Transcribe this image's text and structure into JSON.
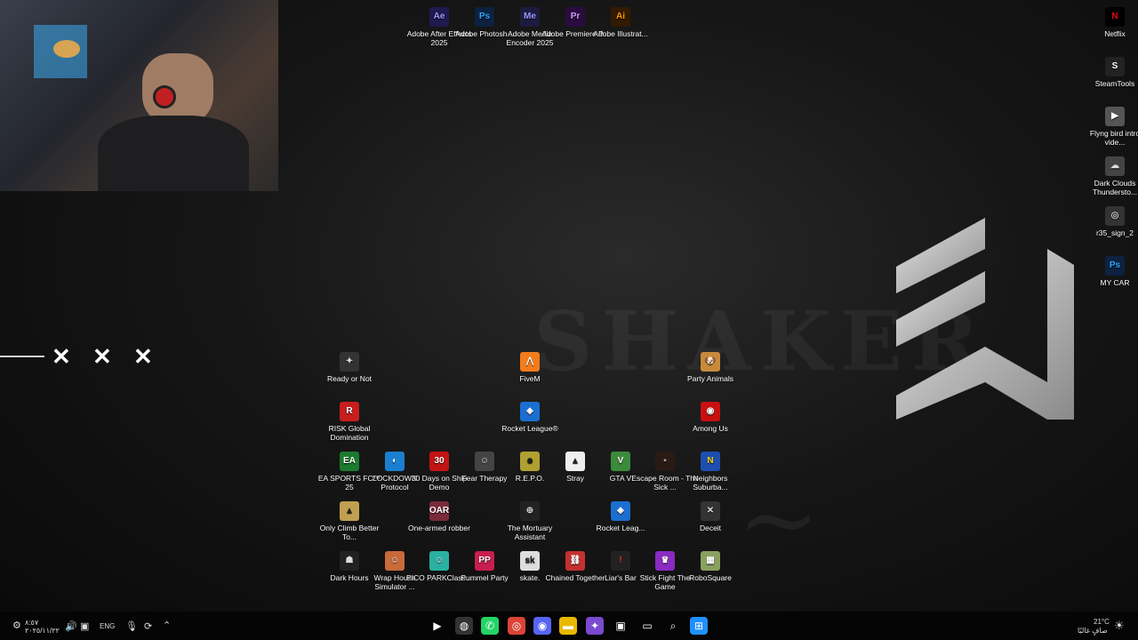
{
  "wallpaper": {
    "brand_text": "SHAKER"
  },
  "top_icons": [
    {
      "label": "Adobe After Effects 2025",
      "glyph": "Ae",
      "color": "#1f1a4f",
      "fg": "#9f9cff"
    },
    {
      "label": "Adobe Photosh...",
      "glyph": "Ps",
      "color": "#0c2240",
      "fg": "#31a8ff"
    },
    {
      "label": "Adobe Media Encoder 2025",
      "glyph": "Me",
      "color": "#1e1a3f",
      "fg": "#9b9bff"
    },
    {
      "label": "Adobe Premiere P...",
      "glyph": "Pr",
      "color": "#2a0c3f",
      "fg": "#d59bff"
    },
    {
      "label": "Adobe Illustrat...",
      "glyph": "Ai",
      "color": "#331a00",
      "fg": "#ff9a00"
    }
  ],
  "right_icons": [
    {
      "label": "Netflix",
      "glyph": "N",
      "color": "#000",
      "fg": "#e50914"
    },
    {
      "label": "SteamTools",
      "glyph": "S",
      "color": "#222",
      "fg": "#fff"
    },
    {
      "label": "Flyng bird intro vide...",
      "glyph": "▶",
      "color": "#555",
      "fg": "#fff"
    },
    {
      "label": "Dark Clouds Thundersto...",
      "glyph": "☁",
      "color": "#444",
      "fg": "#ddd"
    },
    {
      "label": "r35_sign_2",
      "glyph": "◎",
      "color": "#333",
      "fg": "#ccc"
    },
    {
      "label": "MY CAR",
      "glyph": "Ps",
      "color": "#0c2240",
      "fg": "#31a8ff"
    }
  ],
  "grid_icons": [
    {
      "label": "Ready or Not",
      "glyph": "✦",
      "color": "#333",
      "fg": "#ddd"
    },
    {
      "label": "FiveM",
      "glyph": "⋀",
      "color": "#f47c1c",
      "fg": "#fff"
    },
    {
      "label": "Party Animals",
      "glyph": "🐶",
      "color": "#c88a3a",
      "fg": "#fff"
    },
    {
      "label": "RISK Global Domination",
      "glyph": "R",
      "color": "#c81e1e",
      "fg": "#fff"
    },
    {
      "label": "Rocket League®",
      "glyph": "◈",
      "color": "#1a6fd1",
      "fg": "#fff"
    },
    {
      "label": "Among Us",
      "glyph": "◉",
      "color": "#c81010",
      "fg": "#fff"
    },
    {
      "label": "EA SPORTS FC™ 25",
      "glyph": "EA",
      "color": "#1c7a2e",
      "fg": "#fff"
    },
    {
      "label": "LOCKDOWN Protocol",
      "glyph": "◐",
      "color": "#1a7fd0",
      "fg": "#fff"
    },
    {
      "label": "30 Days on Ship Demo",
      "glyph": "30",
      "color": "#c31414",
      "fg": "#fff"
    },
    {
      "label": "Fear Therapy",
      "glyph": "☺",
      "color": "#444",
      "fg": "#eee"
    },
    {
      "label": "R.E.P.O.",
      "glyph": "☻",
      "color": "#b0a030",
      "fg": "#222"
    },
    {
      "label": "Stray",
      "glyph": "▲",
      "color": "#eee",
      "fg": "#222"
    },
    {
      "label": "GTA V",
      "glyph": "V",
      "color": "#3c8a3c",
      "fg": "#fff"
    },
    {
      "label": "Escape Room - The Sick ...",
      "glyph": "▪",
      "color": "#2a1a14",
      "fg": "#aaa"
    },
    {
      "label": "Neighbors Suburba...",
      "glyph": "N",
      "color": "#1e4fb0",
      "fg": "#ffd400"
    },
    {
      "label": "Only Climb Better To...",
      "glyph": "▲",
      "color": "#c0a050",
      "fg": "#222"
    },
    {
      "label": "One-armed robber",
      "glyph": "OAR",
      "color": "#7a2a3a",
      "fg": "#fff"
    },
    {
      "label": "The Mortuary Assistant",
      "glyph": "⊕",
      "color": "#222",
      "fg": "#ccc"
    },
    {
      "label": "Rocket Leag...",
      "glyph": "◈",
      "color": "#1a6fd1",
      "fg": "#fff"
    },
    {
      "label": "Deceit",
      "glyph": "✕",
      "color": "#333",
      "fg": "#ddd"
    },
    {
      "label": "Dark Hours",
      "glyph": "☗",
      "color": "#222",
      "fg": "#ddd"
    },
    {
      "label": "Wrap House Simulator ...",
      "glyph": "☺",
      "color": "#c86a3a",
      "fg": "#fff"
    },
    {
      "label": "PICO PARKClass...",
      "glyph": "☺",
      "color": "#2ab0a0",
      "fg": "#fff"
    },
    {
      "label": "Pummel Party",
      "glyph": "PP",
      "color": "#c81e4e",
      "fg": "#fff"
    },
    {
      "label": "skate.",
      "glyph": "sk",
      "color": "#ddd",
      "fg": "#222"
    },
    {
      "label": "Chained Together",
      "glyph": "⛓",
      "color": "#c43030",
      "fg": "#fff"
    },
    {
      "label": "Liar's Bar",
      "glyph": "!",
      "color": "#222",
      "fg": "#e33"
    },
    {
      "label": "Stick Fight The Game",
      "glyph": "♛",
      "color": "#8a2ac0",
      "fg": "#fff"
    },
    {
      "label": "RoboSquare",
      "glyph": "▦",
      "color": "#8aa060",
      "fg": "#fff"
    }
  ],
  "overlay_marks": [
    "✕",
    "✕",
    "✕"
  ],
  "taskbar": {
    "language": "ENG",
    "time": "٨:٥٧",
    "date": "٢٠٢٥/١١/٢٢",
    "weather_temp": "21°C",
    "weather_desc": "صافٍ غالبًا",
    "apps": [
      {
        "name": "windows-start",
        "glyph": "⊞",
        "color": "#1e90ff"
      },
      {
        "name": "search",
        "glyph": "⌕",
        "color": "transparent"
      },
      {
        "name": "task-view",
        "glyph": "▭",
        "color": "transparent"
      },
      {
        "name": "store",
        "glyph": "▣",
        "color": "transparent"
      },
      {
        "name": "copilot",
        "glyph": "✦",
        "color": "#7a4ad0"
      },
      {
        "name": "file-explorer",
        "glyph": "▬",
        "color": "#e8b800"
      },
      {
        "name": "discord",
        "glyph": "◉",
        "color": "#5865f2"
      },
      {
        "name": "chrome",
        "glyph": "◎",
        "color": "#db4437"
      },
      {
        "name": "whatsapp",
        "glyph": "✆",
        "color": "#25d366"
      },
      {
        "name": "obs",
        "glyph": "◍",
        "color": "#333"
      },
      {
        "name": "media-player",
        "glyph": "▶",
        "color": "transparent"
      }
    ]
  }
}
